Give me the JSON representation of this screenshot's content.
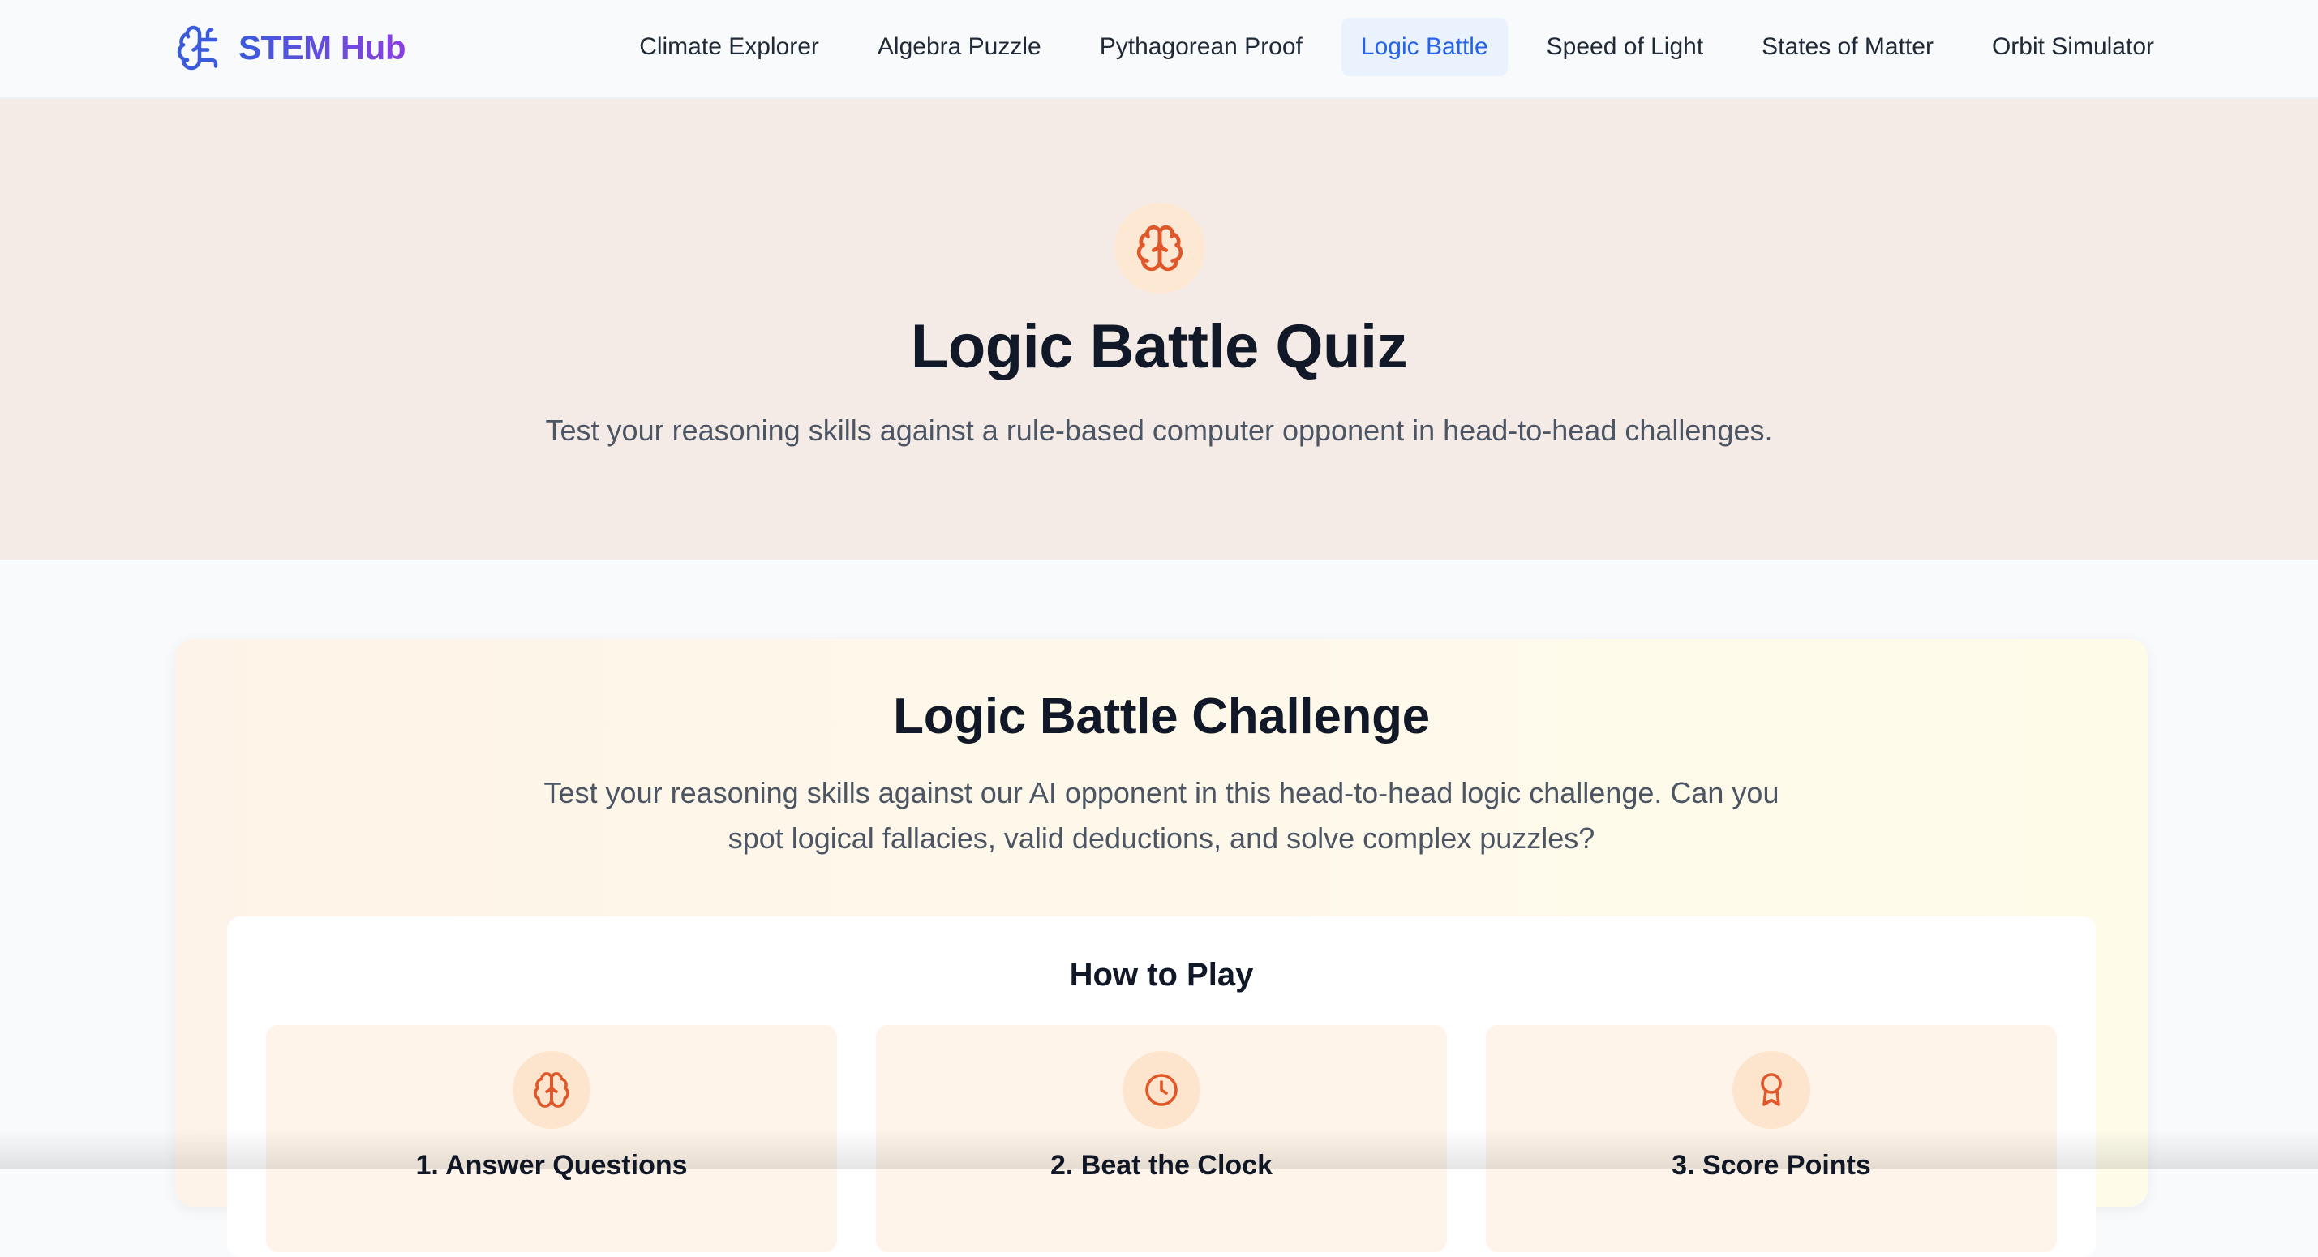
{
  "brand": {
    "name": "STEM Hub",
    "icon": "brain-logo-icon"
  },
  "nav": {
    "items": [
      {
        "label": "Climate Explorer",
        "active": false
      },
      {
        "label": "Algebra Puzzle",
        "active": false
      },
      {
        "label": "Pythagorean Proof",
        "active": false
      },
      {
        "label": "Logic Battle",
        "active": true
      },
      {
        "label": "Speed of Light",
        "active": false
      },
      {
        "label": "States of Matter",
        "active": false
      },
      {
        "label": "Orbit Simulator",
        "active": false
      }
    ]
  },
  "hero": {
    "icon": "brain-icon",
    "title": "Logic Battle Quiz",
    "subtitle": "Test your reasoning skills against a rule-based computer opponent in head-to-head challenges."
  },
  "challenge": {
    "title": "Logic Battle Challenge",
    "description": "Test your reasoning skills against our AI opponent in this head-to-head logic challenge. Can you spot logical fallacies, valid deductions, and solve complex puzzles?",
    "how_to_play": {
      "title": "How to Play",
      "steps": [
        {
          "icon": "brain-icon",
          "label": "1. Answer Questions"
        },
        {
          "icon": "clock-icon",
          "label": "2. Beat the Clock"
        },
        {
          "icon": "award-icon",
          "label": "3. Score Points"
        }
      ]
    }
  },
  "colors": {
    "accent": "#2563eb",
    "brand_gradient_start": "#3b5bdb",
    "brand_gradient_end": "#8b3fe0",
    "icon_orange": "#e0572a",
    "hero_bg": "#f5ebe6"
  }
}
